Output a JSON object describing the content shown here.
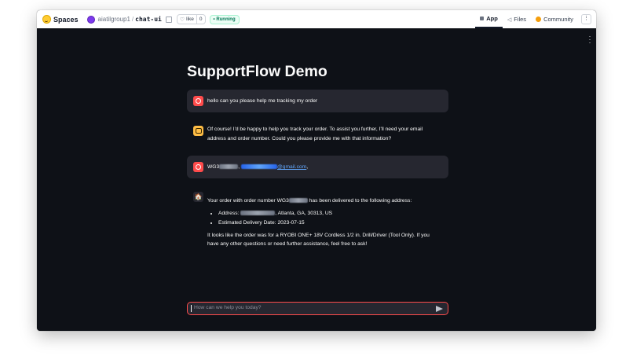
{
  "topbar": {
    "brand": "Spaces",
    "org": "aiatilgroup1",
    "separator": "/",
    "repo": "chat-ui",
    "like_label": "like",
    "like_count": "0",
    "status": "Running",
    "tabs": [
      {
        "label": "App",
        "icon": "app-icon"
      },
      {
        "label": "Files",
        "icon": "files-icon"
      },
      {
        "label": "Community",
        "icon": "community-icon"
      }
    ],
    "more": "⋮"
  },
  "app": {
    "title": "SupportFlow Demo",
    "messages": {
      "m1": {
        "role": "user",
        "text": "hello can you please help me tracking my order"
      },
      "m2": {
        "role": "assistant",
        "text": "Of course! I'd be happy to help you track your order. To assist you further, I'll need your email address and order number. Could you please provide me with that information?"
      },
      "m3": {
        "role": "user",
        "prefix": "WG3",
        "sep": ", ",
        "email_suffix": "@gmail.com",
        "end": ","
      },
      "m4": {
        "role": "assistant",
        "intro_a": "Your order with order number WG3",
        "intro_b": " has been delivered to the following address:",
        "addr_label": "Address: ",
        "addr_rest": ", Atlanta, GA, 30313, US",
        "delivery": "Estimated Delivery Date: 2023-07-15",
        "outro": "It looks like the order was for a RYOBI ONE+ 18V Cordless 1/2 in. Drill/Driver (Tool Only). If you have any other questions or need further assistance, feel free to ask!"
      }
    },
    "input": {
      "placeholder": "How can we help you today?"
    }
  }
}
